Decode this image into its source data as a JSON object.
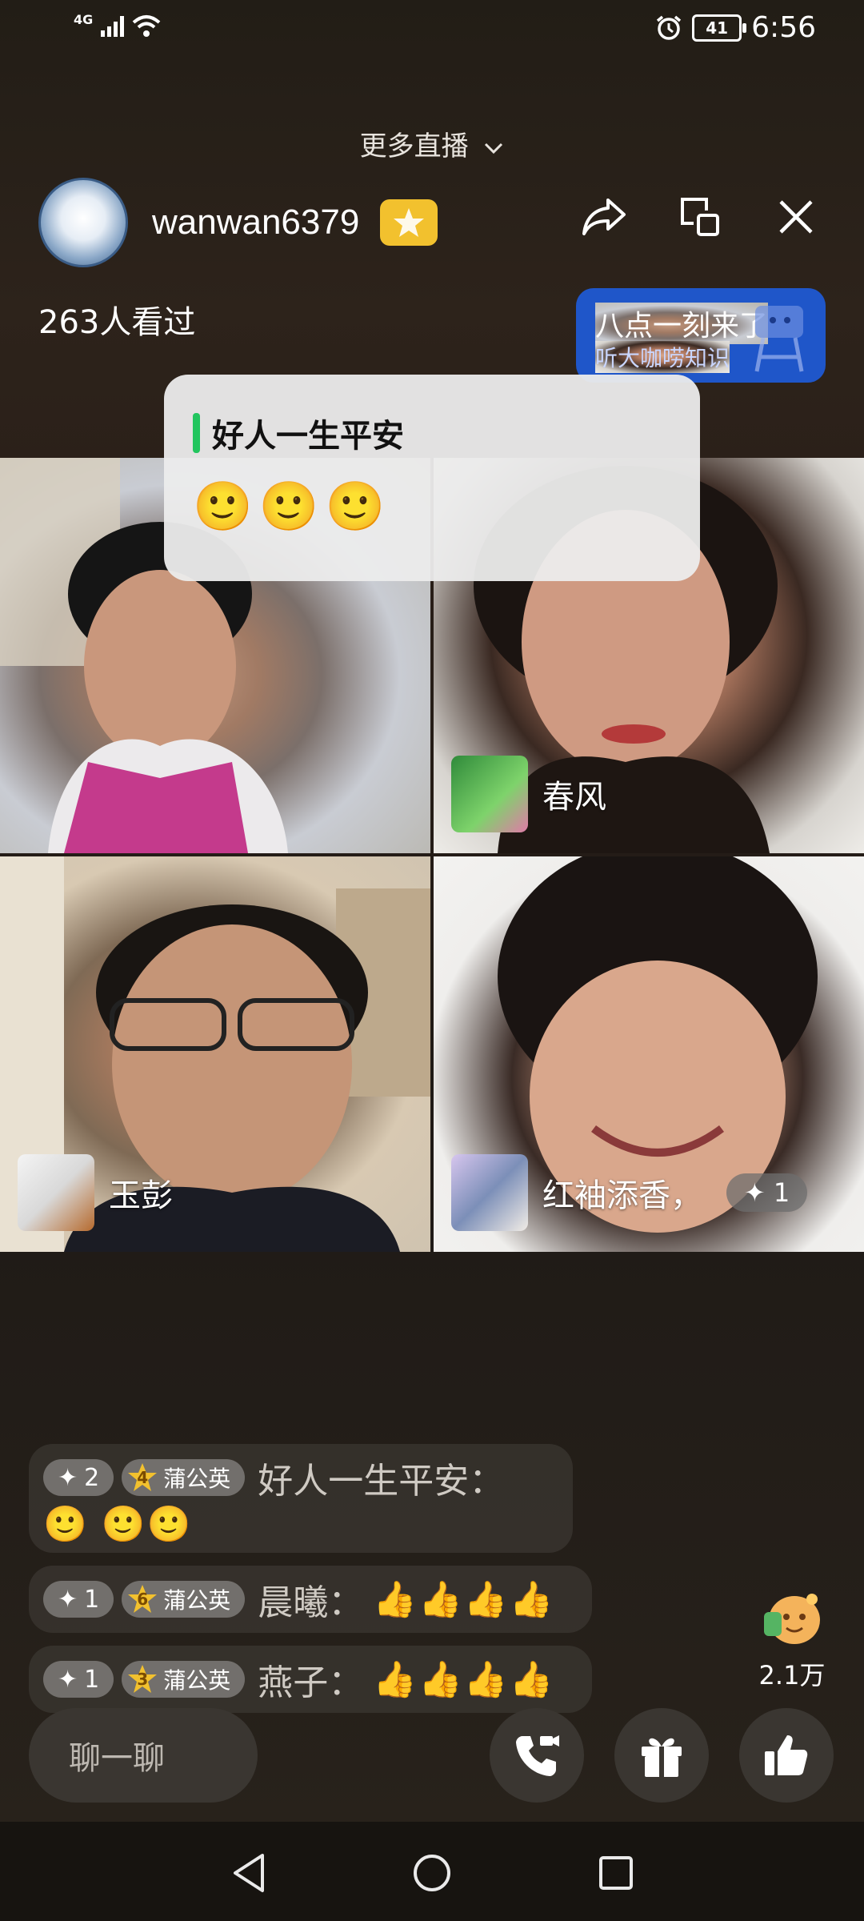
{
  "status_bar": {
    "network": "4G",
    "battery": "41",
    "time": "6:56"
  },
  "header": {
    "more_live_label": "更多直播",
    "streamer_name": "wanwan6379",
    "viewers": "263人看过",
    "icons": [
      "share-icon",
      "screen-switch-icon",
      "close-icon"
    ]
  },
  "promo": {
    "line1": "八点一刻来了",
    "line2": "听大咖唠知识"
  },
  "greeting_popup": {
    "title": "好人一生平安",
    "emoji": "🙂",
    "emoji_count": 3
  },
  "video_tiles": [
    {
      "name": ""
    },
    {
      "name": "春风"
    },
    {
      "name": "玉彭"
    },
    {
      "name": "红袖添香，",
      "plus": "1"
    }
  ],
  "chat": [
    {
      "plus": "2",
      "level": "4",
      "tag": "蒲公英",
      "text": "好人一生平安：",
      "emojis": "🙂 🙂🙂"
    },
    {
      "plus": "1",
      "level": "6",
      "tag": "蒲公英",
      "text": "晨曦：",
      "emojis": "👍👍👍👍"
    },
    {
      "plus": "1",
      "level": "3",
      "tag": "蒲公英",
      "text": "燕子：",
      "emojis": "👍👍👍👍"
    }
  ],
  "likes": {
    "count": "2.1万"
  },
  "bottom_bar": {
    "chat_placeholder": "聊一聊",
    "buttons": [
      "video-call-icon",
      "gift-icon",
      "like-icon"
    ]
  },
  "colors": {
    "accent_green": "#22c55e",
    "badge_yellow": "#f2c12e",
    "promo_blue": "#1f56c9"
  }
}
